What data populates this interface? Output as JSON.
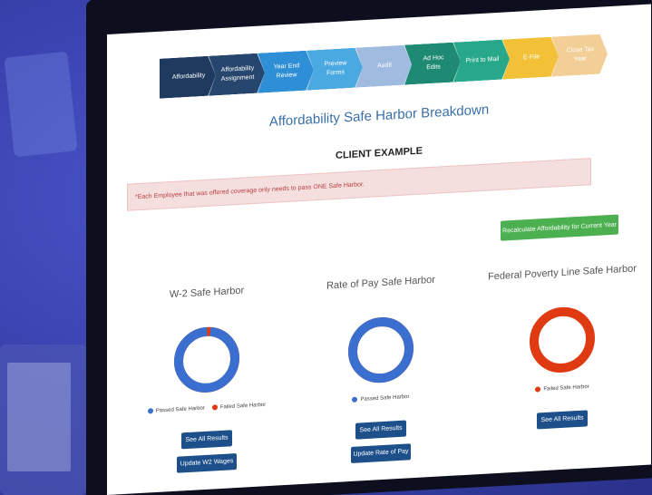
{
  "steps": [
    {
      "label": "Affordability",
      "color": "#1f3a5f"
    },
    {
      "label": "Affordability Assignment",
      "color": "#26466e"
    },
    {
      "label": "Year End Review",
      "color": "#2e8fd6"
    },
    {
      "label": "Preview Forms",
      "color": "#4aa9e0"
    },
    {
      "label": "Audit",
      "color": "#9fbbe0"
    },
    {
      "label": "Ad Hoc Edits",
      "color": "#1e8a74"
    },
    {
      "label": "Print to Mail",
      "color": "#27a88a"
    },
    {
      "label": "E-File",
      "color": "#f2c138"
    },
    {
      "label": "Close Tax Year",
      "color": "#f2cf96"
    }
  ],
  "page": {
    "title": "Affordability Safe Harbor Breakdown",
    "client": "CLIENT EXAMPLE",
    "alert": "*Each Employee that was offered coverage only needs to pass ONE Safe Harbor.",
    "recalc_button": "Recalculate Affordability for Current Year"
  },
  "colors": {
    "passed": "#3a6fd0",
    "failed": "#e03a12"
  },
  "panels": [
    {
      "title": "W-2 Safe Harbor",
      "passed_fraction": 0.98,
      "legend": [
        "Passed Safe Harbor",
        "Failed Safe Harbor"
      ],
      "button1": "See All Results",
      "button2": "Update W2 Wages"
    },
    {
      "title": "Rate of Pay Safe Harbor",
      "passed_fraction": 1.0,
      "legend": [
        "Passed Safe Harbor"
      ],
      "button1": "See All Results",
      "button2": "Update Rate of Pay"
    },
    {
      "title": "Federal Poverty Line Safe Harbor",
      "passed_fraction": 0.0,
      "legend": [
        "Failed Safe Harbor"
      ],
      "button1": "See All Results",
      "button2": ""
    }
  ]
}
